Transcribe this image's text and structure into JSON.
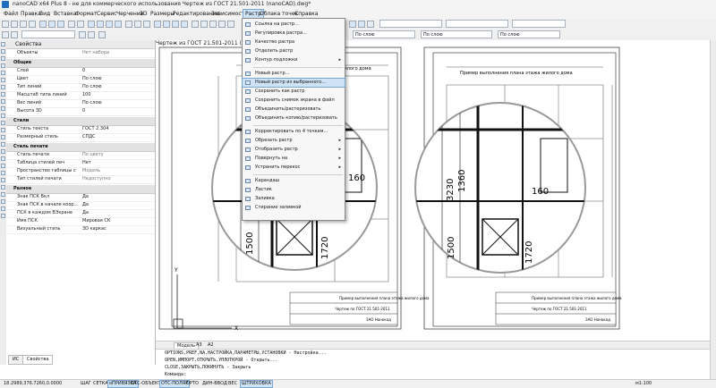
{
  "window": {
    "title": "nanoCAD x64 Plus 8 - не для коммерческого использования Чертеж из ГОСТ 21.501-2011 (nanoCAD).dwg*"
  },
  "menu": [
    "Файл",
    "Правка",
    "Вид",
    "Вставка",
    "Формат",
    "Сервис",
    "Черчение",
    "3D",
    "Размеры",
    "Редактирование",
    "Зависимости",
    "Растр",
    "Облака точек",
    "Справка"
  ],
  "toolbar": {
    "layer_combo": "По слою",
    "linetype_combo": "По слою",
    "lineweight_combo": "По слою"
  },
  "properties": {
    "title": "Свойства",
    "objects_label": "Объекты",
    "objects_value": "Нет набора",
    "sections": [
      {
        "name": "Общие",
        "rows": [
          {
            "k": "Слой",
            "v": "0"
          },
          {
            "k": "Цвет",
            "v": "По слою"
          },
          {
            "k": "Тип линий",
            "v": "По слою"
          },
          {
            "k": "Масштаб типа линий",
            "v": "100"
          },
          {
            "k": "Вес линий",
            "v": "По слою"
          },
          {
            "k": "Высота 3D",
            "v": "0"
          }
        ]
      },
      {
        "name": "Стили",
        "rows": [
          {
            "k": "Стиль текста",
            "v": "ГОСТ 2.304"
          },
          {
            "k": "Размерный стиль",
            "v": "СПДС"
          }
        ]
      },
      {
        "name": "Стиль печати",
        "rows": [
          {
            "k": "Стиль печати",
            "v": "По цвету"
          },
          {
            "k": "Таблица стилей печ",
            "v": "Нет"
          },
          {
            "k": "Пространство таблицы с",
            "v": "Модель"
          },
          {
            "k": "Тип стилей печати",
            "v": "Недоступно"
          }
        ]
      },
      {
        "name": "Разное",
        "rows": [
          {
            "k": "Знак ПСК Вкл",
            "v": "Да"
          },
          {
            "k": "Знак ПСК в начале коор...",
            "v": "Да"
          },
          {
            "k": "ПСК в каждом ВЭкране",
            "v": "Да"
          },
          {
            "k": "Имя ПСК",
            "v": "Мировая СК"
          },
          {
            "k": "Визуальный стиль",
            "v": "3D каркас"
          }
        ]
      }
    ],
    "tabs": [
      "ИС",
      "Свойства"
    ]
  },
  "drawing": {
    "tab_title": "Чертеж из ГОСТ 21.501-2011 (nanoCAD)",
    "plan_title": "Пример выполнения плана этажа жилого дома",
    "dims": [
      "160",
      "1360",
      "3230",
      "1500",
      "1720",
      "160",
      "1360",
      "3230",
      "1500",
      "1720"
    ],
    "stamp_a": "Чертеж по ГОСТ 21.501-2011",
    "stamp_b": "ЗАО Нанокад",
    "stamp_c": "Пример выполнения плана этажа жилого дома",
    "axis_x": "X",
    "axis_y": "Y"
  },
  "raster_menu": {
    "items": [
      {
        "label": "Ссылка на растр...",
        "icon": "link-icon",
        "sub": false
      },
      {
        "label": "Регулировка растра...",
        "icon": "adjust-icon",
        "sub": false
      },
      {
        "label": "Качество растра",
        "icon": "quality-icon",
        "sub": false
      },
      {
        "label": "Отделить растр",
        "icon": "detach-icon",
        "sub": false
      },
      {
        "label": "Контур подложки",
        "icon": "frame-icon",
        "sub": true
      },
      {
        "label": "Новый растр...",
        "icon": "new-raster-icon",
        "sub": false
      },
      {
        "label": "Новый растр из выбранного...",
        "icon": "new-from-selection-icon",
        "sub": false
      },
      {
        "label": "Сохранить как растр",
        "icon": "save-raster-icon",
        "sub": false
      },
      {
        "label": "Сохранить снимок экрана в файл",
        "icon": "screenshot-icon",
        "sub": false
      },
      {
        "label": "Объединить/растеризовать",
        "icon": "merge-icon",
        "sub": false
      },
      {
        "label": "Объединить копию/растеризовать",
        "icon": "merge-copy-icon",
        "sub": false
      },
      {
        "label": "Корректировать по 4 точкам...",
        "icon": "correct-icon",
        "sub": false
      },
      {
        "label": "Обрезать растр",
        "icon": "crop-icon",
        "sub": true
      },
      {
        "label": "Отобразить растр",
        "icon": "mirror-icon",
        "sub": true
      },
      {
        "label": "Повернуть на",
        "icon": "rotate-icon",
        "sub": true
      },
      {
        "label": "Устранить перекос",
        "icon": "deskew-icon",
        "sub": true
      },
      {
        "label": "Карандаш",
        "icon": "pencil-icon",
        "sub": false
      },
      {
        "label": "Ластик",
        "icon": "eraser-icon",
        "sub": false
      },
      {
        "label": "Заливка",
        "icon": "fill-icon",
        "sub": false
      },
      {
        "label": "Стирание заливкой",
        "icon": "fill-erase-icon",
        "sub": false
      }
    ],
    "highlighted": "Новый растр из выбранного..."
  },
  "layout_tabs": [
    "Модель",
    "A3",
    "A2"
  ],
  "command_lines": [
    "OPTIONS,PREF,NA,НАСТРОЙКА,ПАРАМЕТРЫ,УСТАНОВКИ - Настройка...",
    "OPEN,ИМПОРТ,ОТКРЫТЬ,УПЛОТКРОЙ - Открыть...",
    "CLOSE,ЗАКРЫТЬ,ПОКИНУТЬ - Закрыть",
    "Команда:"
  ],
  "status": {
    "coords": "18.2989,376.7260,0.0000",
    "toggles": [
      "ШАГ",
      "СЕТКА",
      "оПРИВЯЗКА",
      "ОТС-ОБЪЕКТ",
      "ОТС-ПОЛЯР",
      "ОРТО",
      "ДИН-ВВОД",
      "ВЕС",
      "ШТРИХОВКА"
    ],
    "scale": "м1:100"
  },
  "colors": {
    "accent": "#cfe3f7",
    "menu_highlight_border": "#7aa7d8"
  }
}
